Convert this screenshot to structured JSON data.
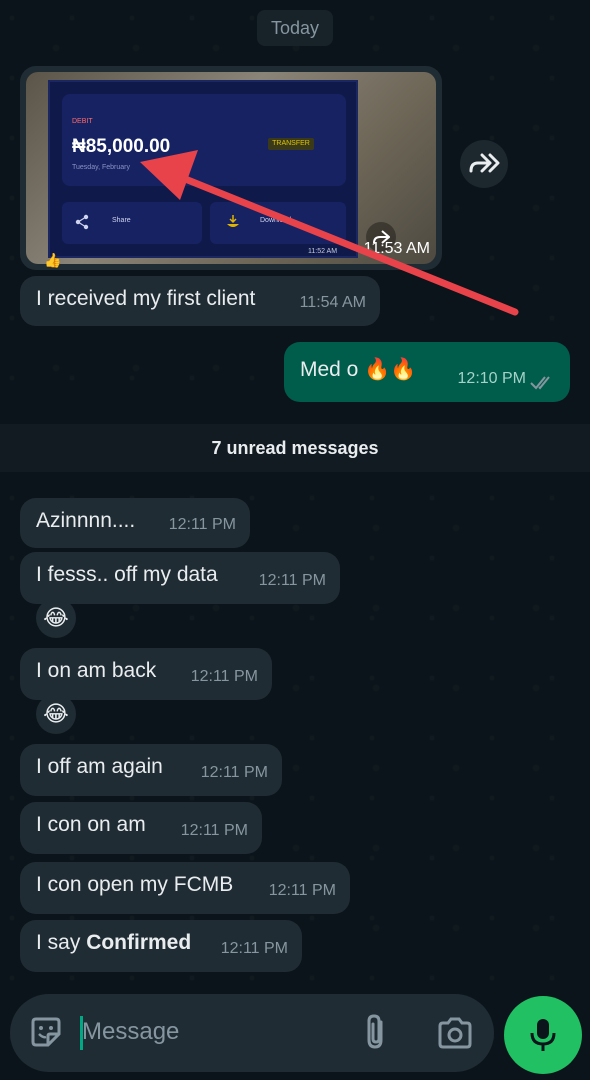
{
  "date_chip": "Today",
  "media_message": {
    "screenshot": {
      "debit_label": "DEBIT",
      "amount": "₦85,000.00",
      "date_text": "Tuesday, February",
      "badge": "TRANSFER",
      "share_label": "Share",
      "download_label": "Download",
      "inner_time": "11:52 AM"
    },
    "time": "11:53 AM",
    "reaction": "👍"
  },
  "messages_before_unread": [
    {
      "text": "I received my first client",
      "time": "11:54 AM",
      "direction": "incoming"
    },
    {
      "text": "Med o 🔥🔥",
      "time": "12:10 PM",
      "direction": "outgoing",
      "status": "read"
    }
  ],
  "unread_banner": "7 unread messages",
  "messages_after_unread": [
    {
      "text": "Azinnnn....",
      "time": "12:11 PM"
    },
    {
      "text": "I fesss.. off my data",
      "time": "12:11 PM",
      "reaction": "😂"
    },
    {
      "text": "I on am back",
      "time": "12:11 PM",
      "reaction": "😂"
    },
    {
      "text": "I off am again",
      "time": "12:11 PM"
    },
    {
      "text": "I con on am",
      "time": "12:11 PM"
    },
    {
      "text": "I con open my FCMB",
      "time": "12:11 PM"
    },
    {
      "text_prefix": "I say ",
      "text_bold": "Confirmed",
      "time": "12:11 PM"
    }
  ],
  "composer": {
    "placeholder": "Message",
    "icons": [
      "sticker-icon",
      "paperclip-icon",
      "camera-icon",
      "microphone-icon"
    ]
  },
  "colors": {
    "background": "#0b141a",
    "incoming_bubble": "#202c33",
    "outgoing_bubble": "#005c4b",
    "accent": "#21c063",
    "annotation_arrow": "#e8434a"
  }
}
